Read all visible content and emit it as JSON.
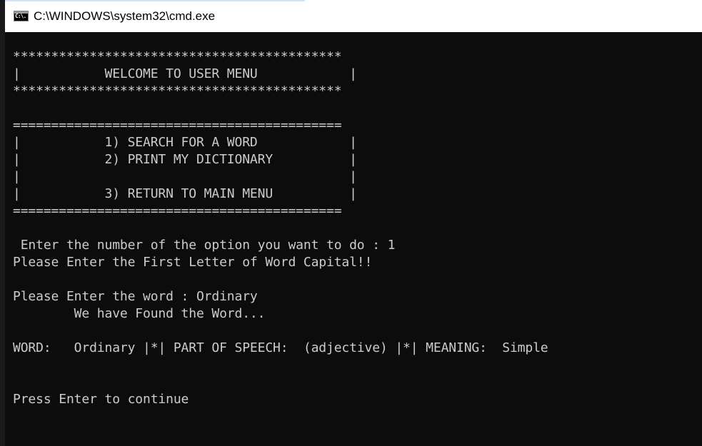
{
  "window": {
    "title": "C:\\WINDOWS\\system32\\cmd.exe",
    "icon": "cmd-icon",
    "icon_text": "C:\\."
  },
  "console": {
    "lines": [
      "*******************************************",
      "|           WELCOME TO USER MENU            |",
      "*******************************************",
      "",
      "===========================================",
      "|           1) SEARCH FOR A WORD            |",
      "|           2) PRINT MY DICTIONARY          |",
      "|                                           |",
      "|           3) RETURN TO MAIN MENU          |",
      "===========================================",
      "",
      " Enter the number of the option you want to do : 1",
      "Please Enter the First Letter of Word Capital!!",
      "",
      "Please Enter the word : Ordinary",
      "        We have Found the Word...",
      "",
      "WORD:   Ordinary |*| PART OF SPEECH:  (adjective) |*| MEANING:  Simple",
      "",
      "",
      "Press Enter to continue"
    ]
  },
  "colors": {
    "console_bg": "#0c0c0c",
    "console_fg": "#cccccc",
    "titlebar_bg": "#ffffff"
  }
}
